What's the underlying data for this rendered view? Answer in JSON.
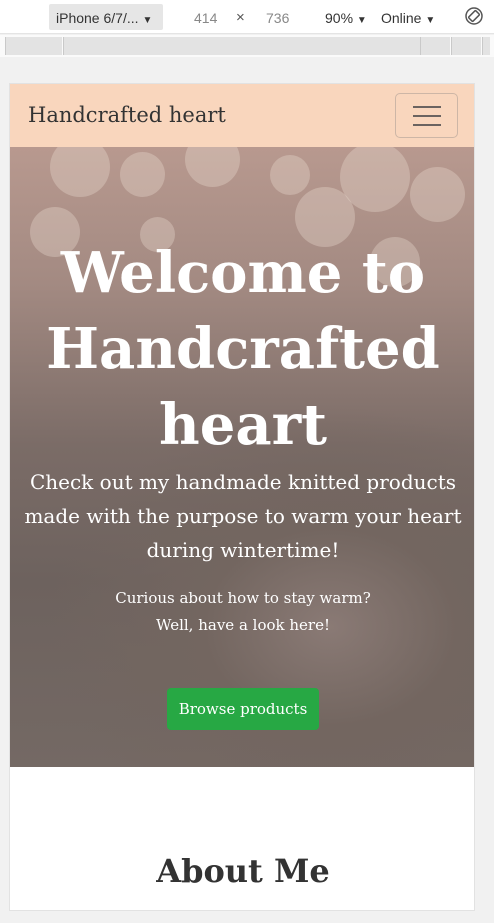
{
  "devtools": {
    "device": "iPhone 6/7/...",
    "width": "414",
    "times": "×",
    "height": "736",
    "zoom": "90%",
    "network": "Online"
  },
  "navbar": {
    "brand": "Handcrafted heart"
  },
  "hero": {
    "title_line1": "Welcome to",
    "title_line2": "Handcrafted",
    "title_line3": "heart",
    "subtitle": "Check out my handmade knitted products made with the purpose to warm your heart during wintertime!",
    "small_line1": "Curious about how to stay warm?",
    "small_line2": "Well, have a look here!",
    "button": "Browse products"
  },
  "about": {
    "heading": "About Me"
  },
  "colors": {
    "navbar_bg": "#f9d6bd",
    "button_bg": "#27a844"
  }
}
